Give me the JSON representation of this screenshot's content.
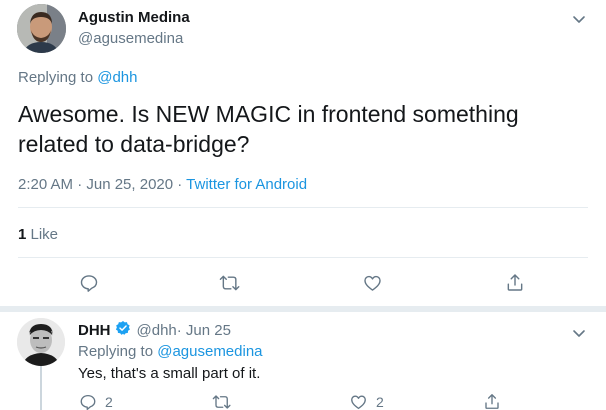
{
  "main_tweet": {
    "author": {
      "name": "Agustin Medina",
      "handle": "@agusemedina"
    },
    "replying_prefix": "Replying to",
    "replying_to": "@dhh",
    "text": "Awesome. Is NEW MAGIC in frontend something related to data-bridge?",
    "timestamp": "2:20 AM · Jun 25, 2020 · ",
    "source": "Twitter for Android",
    "likes_count": "1",
    "likes_label": " Like",
    "actions": {
      "reply": {
        "icon": "comment-icon",
        "count": ""
      },
      "retweet": {
        "icon": "retweet-icon",
        "count": ""
      },
      "like": {
        "icon": "heart-icon",
        "count": ""
      },
      "share": {
        "icon": "share-icon",
        "count": ""
      }
    }
  },
  "reply_tweet": {
    "author": {
      "name": "DHH",
      "handle": "@dhh",
      "verified": true
    },
    "date": " · Jun 25",
    "replying_prefix": "Replying to",
    "replying_to": "@agusemedina",
    "text": "Yes, that's a small part of it.",
    "actions": {
      "reply": {
        "icon": "comment-icon",
        "count": "2"
      },
      "retweet": {
        "icon": "retweet-icon",
        "count": ""
      },
      "like": {
        "icon": "heart-icon",
        "count": "2"
      },
      "share": {
        "icon": "share-icon",
        "count": ""
      }
    }
  },
  "colors": {
    "text": "#14171a",
    "secondary": "#657786",
    "link": "#1b95e0",
    "divider": "#e6ecf0",
    "verified": "#1da1f2"
  }
}
